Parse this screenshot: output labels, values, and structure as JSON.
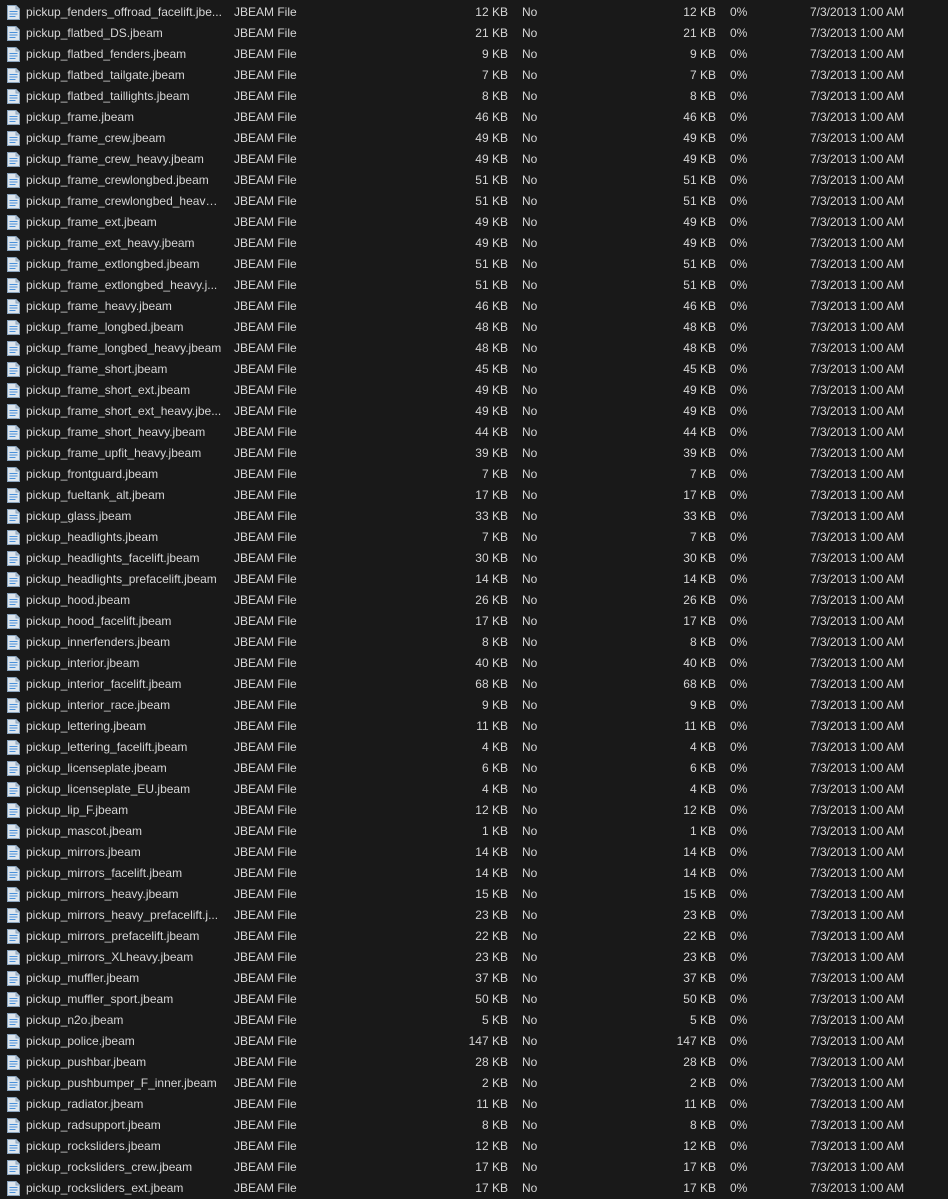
{
  "colors": {
    "background": "#191919",
    "text": "#d6d6d6",
    "icon_fill": "#dde6ee",
    "icon_line": "#4a90d9"
  },
  "file_icon": "jbeam-file-icon",
  "files": [
    {
      "name": "pickup_fenders_offroad_facelift.jbe...",
      "type": "JBEAM File",
      "size": "12 KB",
      "encrypted": "No",
      "compressed": "12 KB",
      "ratio": "0%",
      "modified": "7/3/2013 1:00 AM"
    },
    {
      "name": "pickup_flatbed_DS.jbeam",
      "type": "JBEAM File",
      "size": "21 KB",
      "encrypted": "No",
      "compressed": "21 KB",
      "ratio": "0%",
      "modified": "7/3/2013 1:00 AM"
    },
    {
      "name": "pickup_flatbed_fenders.jbeam",
      "type": "JBEAM File",
      "size": "9 KB",
      "encrypted": "No",
      "compressed": "9 KB",
      "ratio": "0%",
      "modified": "7/3/2013 1:00 AM"
    },
    {
      "name": "pickup_flatbed_tailgate.jbeam",
      "type": "JBEAM File",
      "size": "7 KB",
      "encrypted": "No",
      "compressed": "7 KB",
      "ratio": "0%",
      "modified": "7/3/2013 1:00 AM"
    },
    {
      "name": "pickup_flatbed_taillights.jbeam",
      "type": "JBEAM File",
      "size": "8 KB",
      "encrypted": "No",
      "compressed": "8 KB",
      "ratio": "0%",
      "modified": "7/3/2013 1:00 AM"
    },
    {
      "name": "pickup_frame.jbeam",
      "type": "JBEAM File",
      "size": "46 KB",
      "encrypted": "No",
      "compressed": "46 KB",
      "ratio": "0%",
      "modified": "7/3/2013 1:00 AM"
    },
    {
      "name": "pickup_frame_crew.jbeam",
      "type": "JBEAM File",
      "size": "49 KB",
      "encrypted": "No",
      "compressed": "49 KB",
      "ratio": "0%",
      "modified": "7/3/2013 1:00 AM"
    },
    {
      "name": "pickup_frame_crew_heavy.jbeam",
      "type": "JBEAM File",
      "size": "49 KB",
      "encrypted": "No",
      "compressed": "49 KB",
      "ratio": "0%",
      "modified": "7/3/2013 1:00 AM"
    },
    {
      "name": "pickup_frame_crewlongbed.jbeam",
      "type": "JBEAM File",
      "size": "51 KB",
      "encrypted": "No",
      "compressed": "51 KB",
      "ratio": "0%",
      "modified": "7/3/2013 1:00 AM"
    },
    {
      "name": "pickup_frame_crewlongbed_heavy....",
      "type": "JBEAM File",
      "size": "51 KB",
      "encrypted": "No",
      "compressed": "51 KB",
      "ratio": "0%",
      "modified": "7/3/2013 1:00 AM"
    },
    {
      "name": "pickup_frame_ext.jbeam",
      "type": "JBEAM File",
      "size": "49 KB",
      "encrypted": "No",
      "compressed": "49 KB",
      "ratio": "0%",
      "modified": "7/3/2013 1:00 AM"
    },
    {
      "name": "pickup_frame_ext_heavy.jbeam",
      "type": "JBEAM File",
      "size": "49 KB",
      "encrypted": "No",
      "compressed": "49 KB",
      "ratio": "0%",
      "modified": "7/3/2013 1:00 AM"
    },
    {
      "name": "pickup_frame_extlongbed.jbeam",
      "type": "JBEAM File",
      "size": "51 KB",
      "encrypted": "No",
      "compressed": "51 KB",
      "ratio": "0%",
      "modified": "7/3/2013 1:00 AM"
    },
    {
      "name": "pickup_frame_extlongbed_heavy.j...",
      "type": "JBEAM File",
      "size": "51 KB",
      "encrypted": "No",
      "compressed": "51 KB",
      "ratio": "0%",
      "modified": "7/3/2013 1:00 AM"
    },
    {
      "name": "pickup_frame_heavy.jbeam",
      "type": "JBEAM File",
      "size": "46 KB",
      "encrypted": "No",
      "compressed": "46 KB",
      "ratio": "0%",
      "modified": "7/3/2013 1:00 AM"
    },
    {
      "name": "pickup_frame_longbed.jbeam",
      "type": "JBEAM File",
      "size": "48 KB",
      "encrypted": "No",
      "compressed": "48 KB",
      "ratio": "0%",
      "modified": "7/3/2013 1:00 AM"
    },
    {
      "name": "pickup_frame_longbed_heavy.jbeam",
      "type": "JBEAM File",
      "size": "48 KB",
      "encrypted": "No",
      "compressed": "48 KB",
      "ratio": "0%",
      "modified": "7/3/2013 1:00 AM"
    },
    {
      "name": "pickup_frame_short.jbeam",
      "type": "JBEAM File",
      "size": "45 KB",
      "encrypted": "No",
      "compressed": "45 KB",
      "ratio": "0%",
      "modified": "7/3/2013 1:00 AM"
    },
    {
      "name": "pickup_frame_short_ext.jbeam",
      "type": "JBEAM File",
      "size": "49 KB",
      "encrypted": "No",
      "compressed": "49 KB",
      "ratio": "0%",
      "modified": "7/3/2013 1:00 AM"
    },
    {
      "name": "pickup_frame_short_ext_heavy.jbe...",
      "type": "JBEAM File",
      "size": "49 KB",
      "encrypted": "No",
      "compressed": "49 KB",
      "ratio": "0%",
      "modified": "7/3/2013 1:00 AM"
    },
    {
      "name": "pickup_frame_short_heavy.jbeam",
      "type": "JBEAM File",
      "size": "44 KB",
      "encrypted": "No",
      "compressed": "44 KB",
      "ratio": "0%",
      "modified": "7/3/2013 1:00 AM"
    },
    {
      "name": "pickup_frame_upfit_heavy.jbeam",
      "type": "JBEAM File",
      "size": "39 KB",
      "encrypted": "No",
      "compressed": "39 KB",
      "ratio": "0%",
      "modified": "7/3/2013 1:00 AM"
    },
    {
      "name": "pickup_frontguard.jbeam",
      "type": "JBEAM File",
      "size": "7 KB",
      "encrypted": "No",
      "compressed": "7 KB",
      "ratio": "0%",
      "modified": "7/3/2013 1:00 AM"
    },
    {
      "name": "pickup_fueltank_alt.jbeam",
      "type": "JBEAM File",
      "size": "17 KB",
      "encrypted": "No",
      "compressed": "17 KB",
      "ratio": "0%",
      "modified": "7/3/2013 1:00 AM"
    },
    {
      "name": "pickup_glass.jbeam",
      "type": "JBEAM File",
      "size": "33 KB",
      "encrypted": "No",
      "compressed": "33 KB",
      "ratio": "0%",
      "modified": "7/3/2013 1:00 AM"
    },
    {
      "name": "pickup_headlights.jbeam",
      "type": "JBEAM File",
      "size": "7 KB",
      "encrypted": "No",
      "compressed": "7 KB",
      "ratio": "0%",
      "modified": "7/3/2013 1:00 AM"
    },
    {
      "name": "pickup_headlights_facelift.jbeam",
      "type": "JBEAM File",
      "size": "30 KB",
      "encrypted": "No",
      "compressed": "30 KB",
      "ratio": "0%",
      "modified": "7/3/2013 1:00 AM"
    },
    {
      "name": "pickup_headlights_prefacelift.jbeam",
      "type": "JBEAM File",
      "size": "14 KB",
      "encrypted": "No",
      "compressed": "14 KB",
      "ratio": "0%",
      "modified": "7/3/2013 1:00 AM"
    },
    {
      "name": "pickup_hood.jbeam",
      "type": "JBEAM File",
      "size": "26 KB",
      "encrypted": "No",
      "compressed": "26 KB",
      "ratio": "0%",
      "modified": "7/3/2013 1:00 AM"
    },
    {
      "name": "pickup_hood_facelift.jbeam",
      "type": "JBEAM File",
      "size": "17 KB",
      "encrypted": "No",
      "compressed": "17 KB",
      "ratio": "0%",
      "modified": "7/3/2013 1:00 AM"
    },
    {
      "name": "pickup_innerfenders.jbeam",
      "type": "JBEAM File",
      "size": "8 KB",
      "encrypted": "No",
      "compressed": "8 KB",
      "ratio": "0%",
      "modified": "7/3/2013 1:00 AM"
    },
    {
      "name": "pickup_interior.jbeam",
      "type": "JBEAM File",
      "size": "40 KB",
      "encrypted": "No",
      "compressed": "40 KB",
      "ratio": "0%",
      "modified": "7/3/2013 1:00 AM"
    },
    {
      "name": "pickup_interior_facelift.jbeam",
      "type": "JBEAM File",
      "size": "68 KB",
      "encrypted": "No",
      "compressed": "68 KB",
      "ratio": "0%",
      "modified": "7/3/2013 1:00 AM"
    },
    {
      "name": "pickup_interior_race.jbeam",
      "type": "JBEAM File",
      "size": "9 KB",
      "encrypted": "No",
      "compressed": "9 KB",
      "ratio": "0%",
      "modified": "7/3/2013 1:00 AM"
    },
    {
      "name": "pickup_lettering.jbeam",
      "type": "JBEAM File",
      "size": "11 KB",
      "encrypted": "No",
      "compressed": "11 KB",
      "ratio": "0%",
      "modified": "7/3/2013 1:00 AM"
    },
    {
      "name": "pickup_lettering_facelift.jbeam",
      "type": "JBEAM File",
      "size": "4 KB",
      "encrypted": "No",
      "compressed": "4 KB",
      "ratio": "0%",
      "modified": "7/3/2013 1:00 AM"
    },
    {
      "name": "pickup_licenseplate.jbeam",
      "type": "JBEAM File",
      "size": "6 KB",
      "encrypted": "No",
      "compressed": "6 KB",
      "ratio": "0%",
      "modified": "7/3/2013 1:00 AM"
    },
    {
      "name": "pickup_licenseplate_EU.jbeam",
      "type": "JBEAM File",
      "size": "4 KB",
      "encrypted": "No",
      "compressed": "4 KB",
      "ratio": "0%",
      "modified": "7/3/2013 1:00 AM"
    },
    {
      "name": "pickup_lip_F.jbeam",
      "type": "JBEAM File",
      "size": "12 KB",
      "encrypted": "No",
      "compressed": "12 KB",
      "ratio": "0%",
      "modified": "7/3/2013 1:00 AM"
    },
    {
      "name": "pickup_mascot.jbeam",
      "type": "JBEAM File",
      "size": "1 KB",
      "encrypted": "No",
      "compressed": "1 KB",
      "ratio": "0%",
      "modified": "7/3/2013 1:00 AM"
    },
    {
      "name": "pickup_mirrors.jbeam",
      "type": "JBEAM File",
      "size": "14 KB",
      "encrypted": "No",
      "compressed": "14 KB",
      "ratio": "0%",
      "modified": "7/3/2013 1:00 AM"
    },
    {
      "name": "pickup_mirrors_facelift.jbeam",
      "type": "JBEAM File",
      "size": "14 KB",
      "encrypted": "No",
      "compressed": "14 KB",
      "ratio": "0%",
      "modified": "7/3/2013 1:00 AM"
    },
    {
      "name": "pickup_mirrors_heavy.jbeam",
      "type": "JBEAM File",
      "size": "15 KB",
      "encrypted": "No",
      "compressed": "15 KB",
      "ratio": "0%",
      "modified": "7/3/2013 1:00 AM"
    },
    {
      "name": "pickup_mirrors_heavy_prefacelift.j...",
      "type": "JBEAM File",
      "size": "23 KB",
      "encrypted": "No",
      "compressed": "23 KB",
      "ratio": "0%",
      "modified": "7/3/2013 1:00 AM"
    },
    {
      "name": "pickup_mirrors_prefacelift.jbeam",
      "type": "JBEAM File",
      "size": "22 KB",
      "encrypted": "No",
      "compressed": "22 KB",
      "ratio": "0%",
      "modified": "7/3/2013 1:00 AM"
    },
    {
      "name": "pickup_mirrors_XLheavy.jbeam",
      "type": "JBEAM File",
      "size": "23 KB",
      "encrypted": "No",
      "compressed": "23 KB",
      "ratio": "0%",
      "modified": "7/3/2013 1:00 AM"
    },
    {
      "name": "pickup_muffler.jbeam",
      "type": "JBEAM File",
      "size": "37 KB",
      "encrypted": "No",
      "compressed": "37 KB",
      "ratio": "0%",
      "modified": "7/3/2013 1:00 AM"
    },
    {
      "name": "pickup_muffler_sport.jbeam",
      "type": "JBEAM File",
      "size": "50 KB",
      "encrypted": "No",
      "compressed": "50 KB",
      "ratio": "0%",
      "modified": "7/3/2013 1:00 AM"
    },
    {
      "name": "pickup_n2o.jbeam",
      "type": "JBEAM File",
      "size": "5 KB",
      "encrypted": "No",
      "compressed": "5 KB",
      "ratio": "0%",
      "modified": "7/3/2013 1:00 AM"
    },
    {
      "name": "pickup_police.jbeam",
      "type": "JBEAM File",
      "size": "147 KB",
      "encrypted": "No",
      "compressed": "147 KB",
      "ratio": "0%",
      "modified": "7/3/2013 1:00 AM"
    },
    {
      "name": "pickup_pushbar.jbeam",
      "type": "JBEAM File",
      "size": "28 KB",
      "encrypted": "No",
      "compressed": "28 KB",
      "ratio": "0%",
      "modified": "7/3/2013 1:00 AM"
    },
    {
      "name": "pickup_pushbumper_F_inner.jbeam",
      "type": "JBEAM File",
      "size": "2 KB",
      "encrypted": "No",
      "compressed": "2 KB",
      "ratio": "0%",
      "modified": "7/3/2013 1:00 AM"
    },
    {
      "name": "pickup_radiator.jbeam",
      "type": "JBEAM File",
      "size": "11 KB",
      "encrypted": "No",
      "compressed": "11 KB",
      "ratio": "0%",
      "modified": "7/3/2013 1:00 AM"
    },
    {
      "name": "pickup_radsupport.jbeam",
      "type": "JBEAM File",
      "size": "8 KB",
      "encrypted": "No",
      "compressed": "8 KB",
      "ratio": "0%",
      "modified": "7/3/2013 1:00 AM"
    },
    {
      "name": "pickup_rocksliders.jbeam",
      "type": "JBEAM File",
      "size": "12 KB",
      "encrypted": "No",
      "compressed": "12 KB",
      "ratio": "0%",
      "modified": "7/3/2013 1:00 AM"
    },
    {
      "name": "pickup_rocksliders_crew.jbeam",
      "type": "JBEAM File",
      "size": "17 KB",
      "encrypted": "No",
      "compressed": "17 KB",
      "ratio": "0%",
      "modified": "7/3/2013 1:00 AM"
    },
    {
      "name": "pickup_rocksliders_ext.jbeam",
      "type": "JBEAM File",
      "size": "17 KB",
      "encrypted": "No",
      "compressed": "17 KB",
      "ratio": "0%",
      "modified": "7/3/2013 1:00 AM"
    }
  ]
}
